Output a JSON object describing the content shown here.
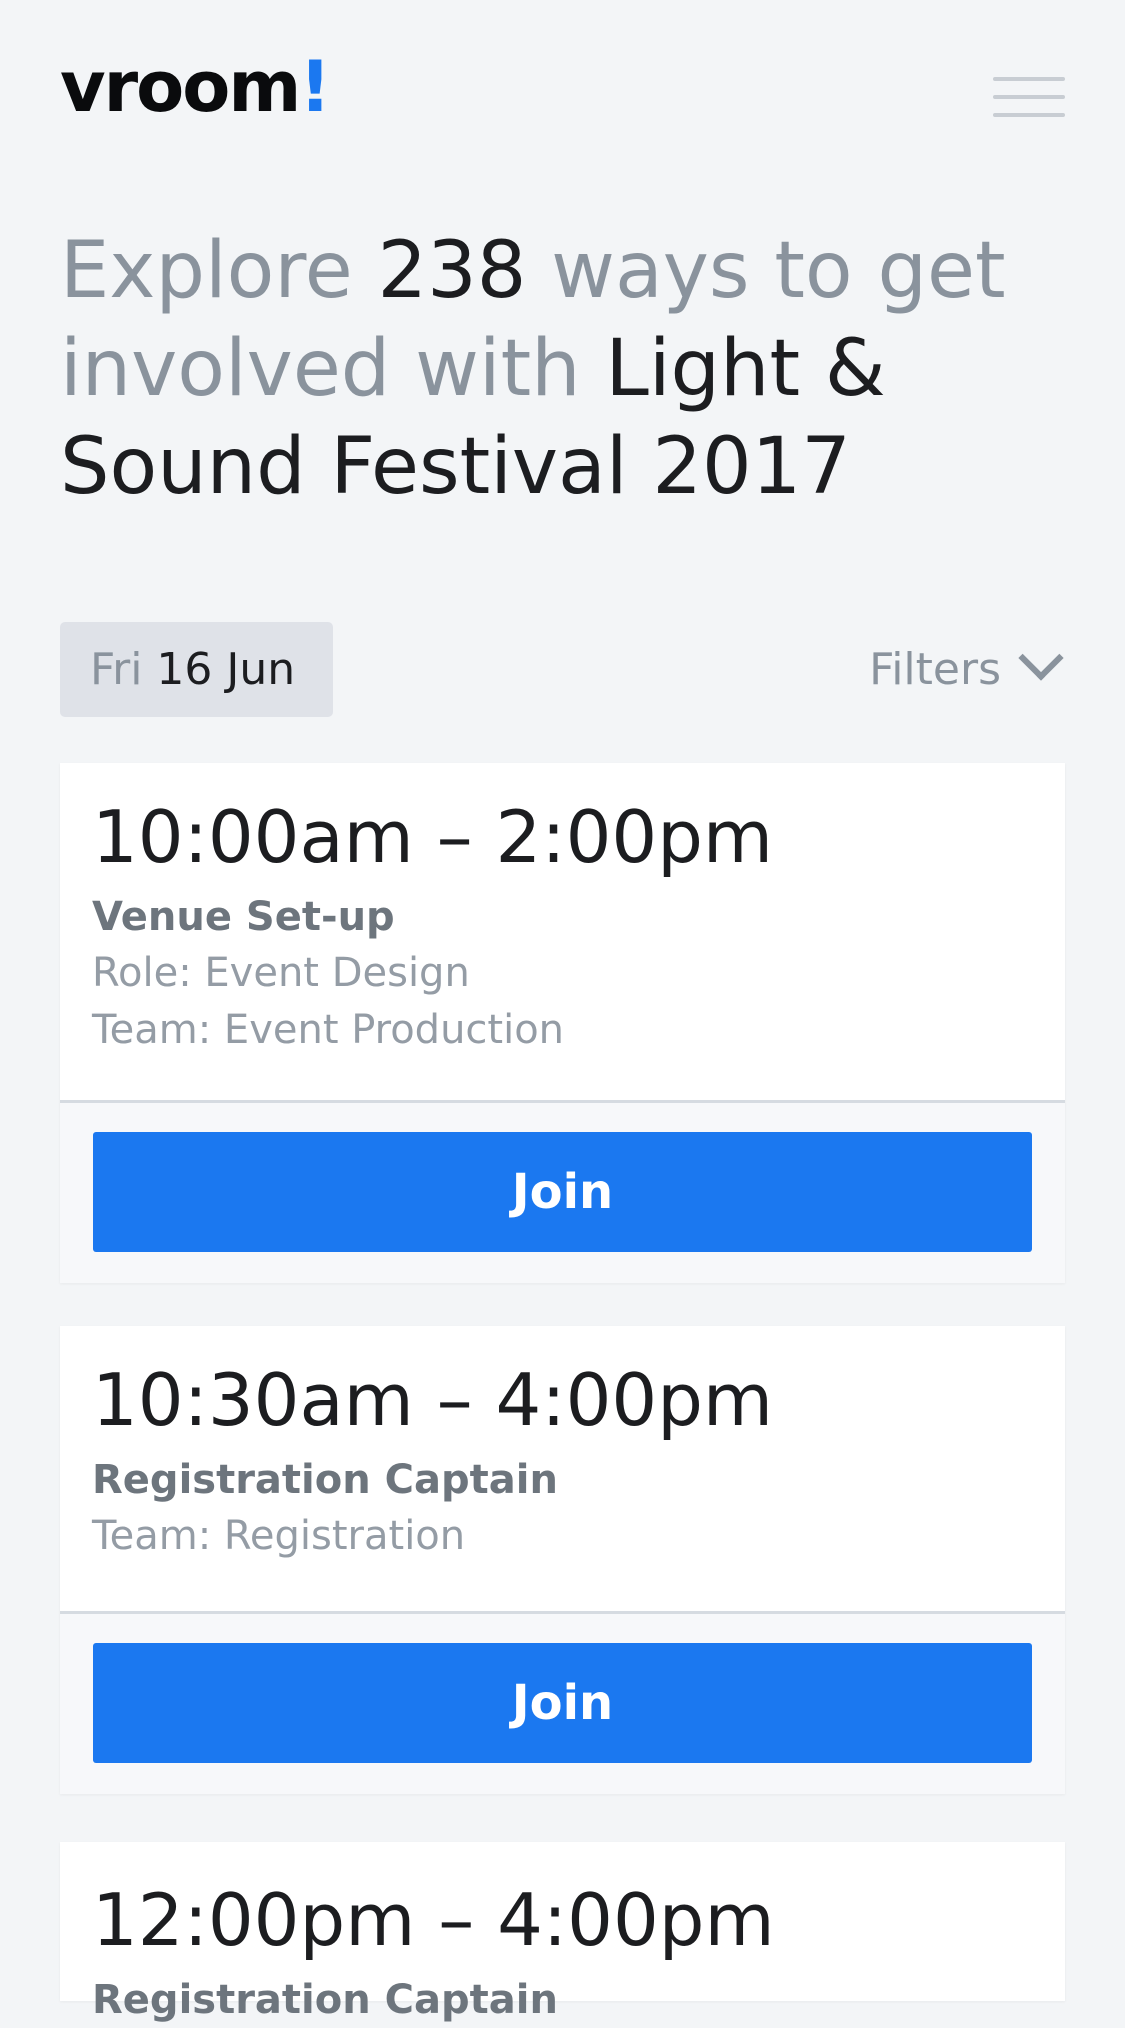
{
  "brand": {
    "name": "vroom",
    "mark": "!",
    "accent": "#1b78f0"
  },
  "headline": {
    "prefix": "Explore ",
    "count": "238",
    "middle": " ways to get involved with ",
    "event": "Light & Sound Festival 2017"
  },
  "date_chip": {
    "dow": "Fri",
    "day": "16 Jun"
  },
  "filters": {
    "label": "Filters"
  },
  "shifts": [
    {
      "time": "10:00am – 2:00pm",
      "name": "Venue Set-up",
      "role": "Role: Event Design",
      "team": "Team: Event Production",
      "button": "Join"
    },
    {
      "time": "10:30am – 4:00pm",
      "name": "Registration Captain",
      "team": "Team: Registration",
      "button": "Join"
    },
    {
      "time": "12:00pm – 4:00pm",
      "name": "Registration Captain"
    }
  ]
}
